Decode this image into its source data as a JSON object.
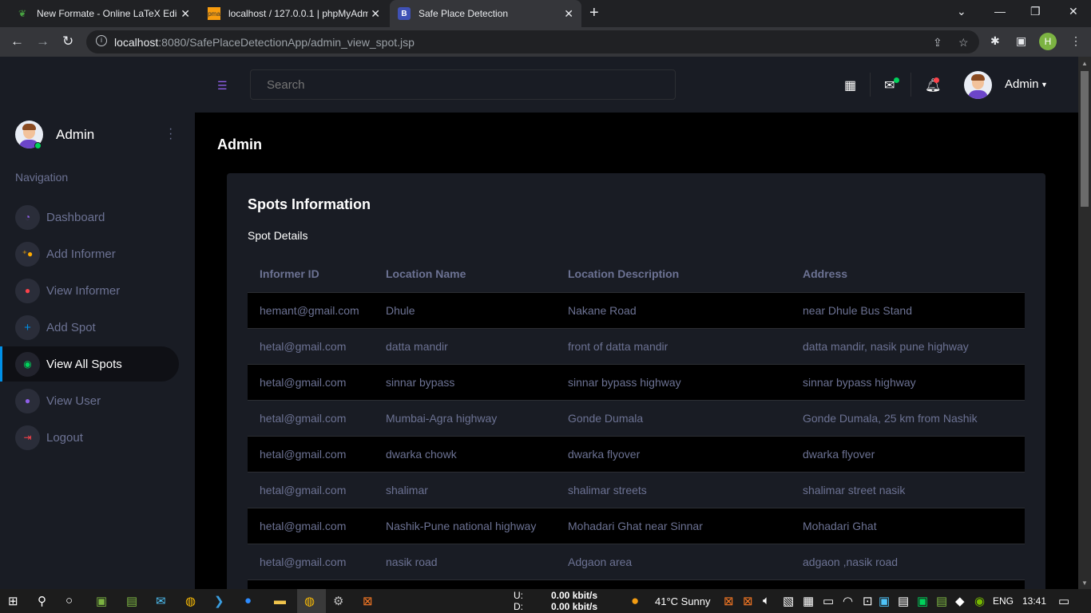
{
  "browser": {
    "tabs": [
      {
        "title": "New Formate - Online LaTeX Edit",
        "icon": "overleaf-icon",
        "active": false
      },
      {
        "title": "localhost / 127.0.0.1 | phpMyAdm",
        "icon": "phpmyadmin-icon",
        "active": false
      },
      {
        "title": "Safe Place Detection",
        "icon": "bootstrap-icon",
        "active": true
      }
    ],
    "url_host": "localhost",
    "url_path": ":8080/SafePlaceDetectionApp/admin_view_spot.jsp",
    "profile_initial": "H"
  },
  "sidebar": {
    "user_name": "Admin",
    "nav_heading": "Navigation",
    "items": [
      {
        "label": "Dashboard",
        "icon": "speedometer-icon",
        "color": "#8f5fe8"
      },
      {
        "label": "Add Informer",
        "icon": "account-plus-icon",
        "color": "#ffab00"
      },
      {
        "label": "View Informer",
        "icon": "account-icon",
        "color": "#fc424a"
      },
      {
        "label": "Add Spot",
        "icon": "plus-icon",
        "color": "#0090e7"
      },
      {
        "label": "View All Spots",
        "icon": "eye-icon",
        "color": "#00d25b"
      },
      {
        "label": "View User",
        "icon": "account-icon",
        "color": "#8f5fe8"
      },
      {
        "label": "Logout",
        "icon": "logout-icon",
        "color": "#fc424a"
      }
    ]
  },
  "header": {
    "search_placeholder": "Search",
    "user_name": "Admin"
  },
  "main": {
    "page_title": "Admin",
    "card_title": "Spots Information",
    "card_description": "Spot Details",
    "columns": [
      "Informer ID",
      "Location Name",
      "Location Description",
      "Address"
    ],
    "rows": [
      [
        "hemant@gmail.com",
        "Dhule",
        "Nakane Road",
        "near Dhule Bus Stand"
      ],
      [
        "hetal@gmail.com",
        "datta mandir",
        "front of datta mandir",
        "datta mandir, nasik pune highway"
      ],
      [
        "hetal@gmail.com",
        "sinnar bypass",
        "sinnar bypass highway",
        "sinnar bypass highway"
      ],
      [
        "hetal@gmail.com",
        "Mumbai-Agra highway",
        "Gonde Dumala",
        "Gonde Dumala, 25 km from Nashik"
      ],
      [
        "hetal@gmail.com",
        "dwarka chowk",
        "dwarka flyover",
        "dwarka flyover"
      ],
      [
        "hetal@gmail.com",
        "shalimar",
        "shalimar streets",
        "shalimar street nasik"
      ],
      [
        "hetal@gmail.com",
        "Nashik-Pune national highway",
        "Mohadari Ghat near Sinnar",
        "Mohadari Ghat"
      ],
      [
        "hetal@gmail.com",
        "nasik road",
        "Adgaon area",
        "adgaon ,nasik road"
      ]
    ]
  },
  "taskbar": {
    "net_up_label": "U:",
    "net_down_label": "D:",
    "net_up_value": "0.00 kbit/s",
    "net_down_value": "0.00 kbit/s",
    "weather": "41°C  Sunny",
    "language": "ENG",
    "time": "13:41"
  }
}
